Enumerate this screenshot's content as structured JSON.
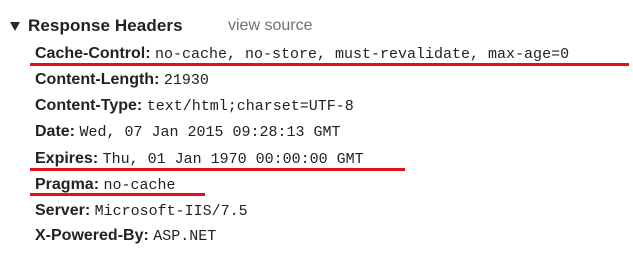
{
  "section": {
    "title": "Response Headers",
    "view_source_label": "view source"
  },
  "headers": [
    {
      "key": "Cache-Control:",
      "value": "no-cache, no-store, must-revalidate, max-age=0",
      "highlighted": true
    },
    {
      "key": "Content-Length:",
      "value": "21930",
      "highlighted": false
    },
    {
      "key": "Content-Type:",
      "value": "text/html;charset=UTF-8",
      "highlighted": false
    },
    {
      "key": "Date:",
      "value": "Wed, 07 Jan 2015 09:28:13 GMT",
      "highlighted": false
    },
    {
      "key": "Expires:",
      "value": "Thu, 01 Jan 1970 00:00:00 GMT",
      "highlighted": true
    },
    {
      "key": "Pragma:",
      "value": "no-cache",
      "highlighted": true
    },
    {
      "key": "Server:",
      "value": "Microsoft-IIS/7.5",
      "highlighted": false
    },
    {
      "key": "X-Powered-By:",
      "value": "ASP.NET",
      "highlighted": false
    }
  ],
  "colors": {
    "highlight_underline": "#e0101a",
    "view_source_text": "#6f6f6f",
    "text": "#222222"
  },
  "icons": {
    "section_toggle": "triangle-down-icon"
  }
}
